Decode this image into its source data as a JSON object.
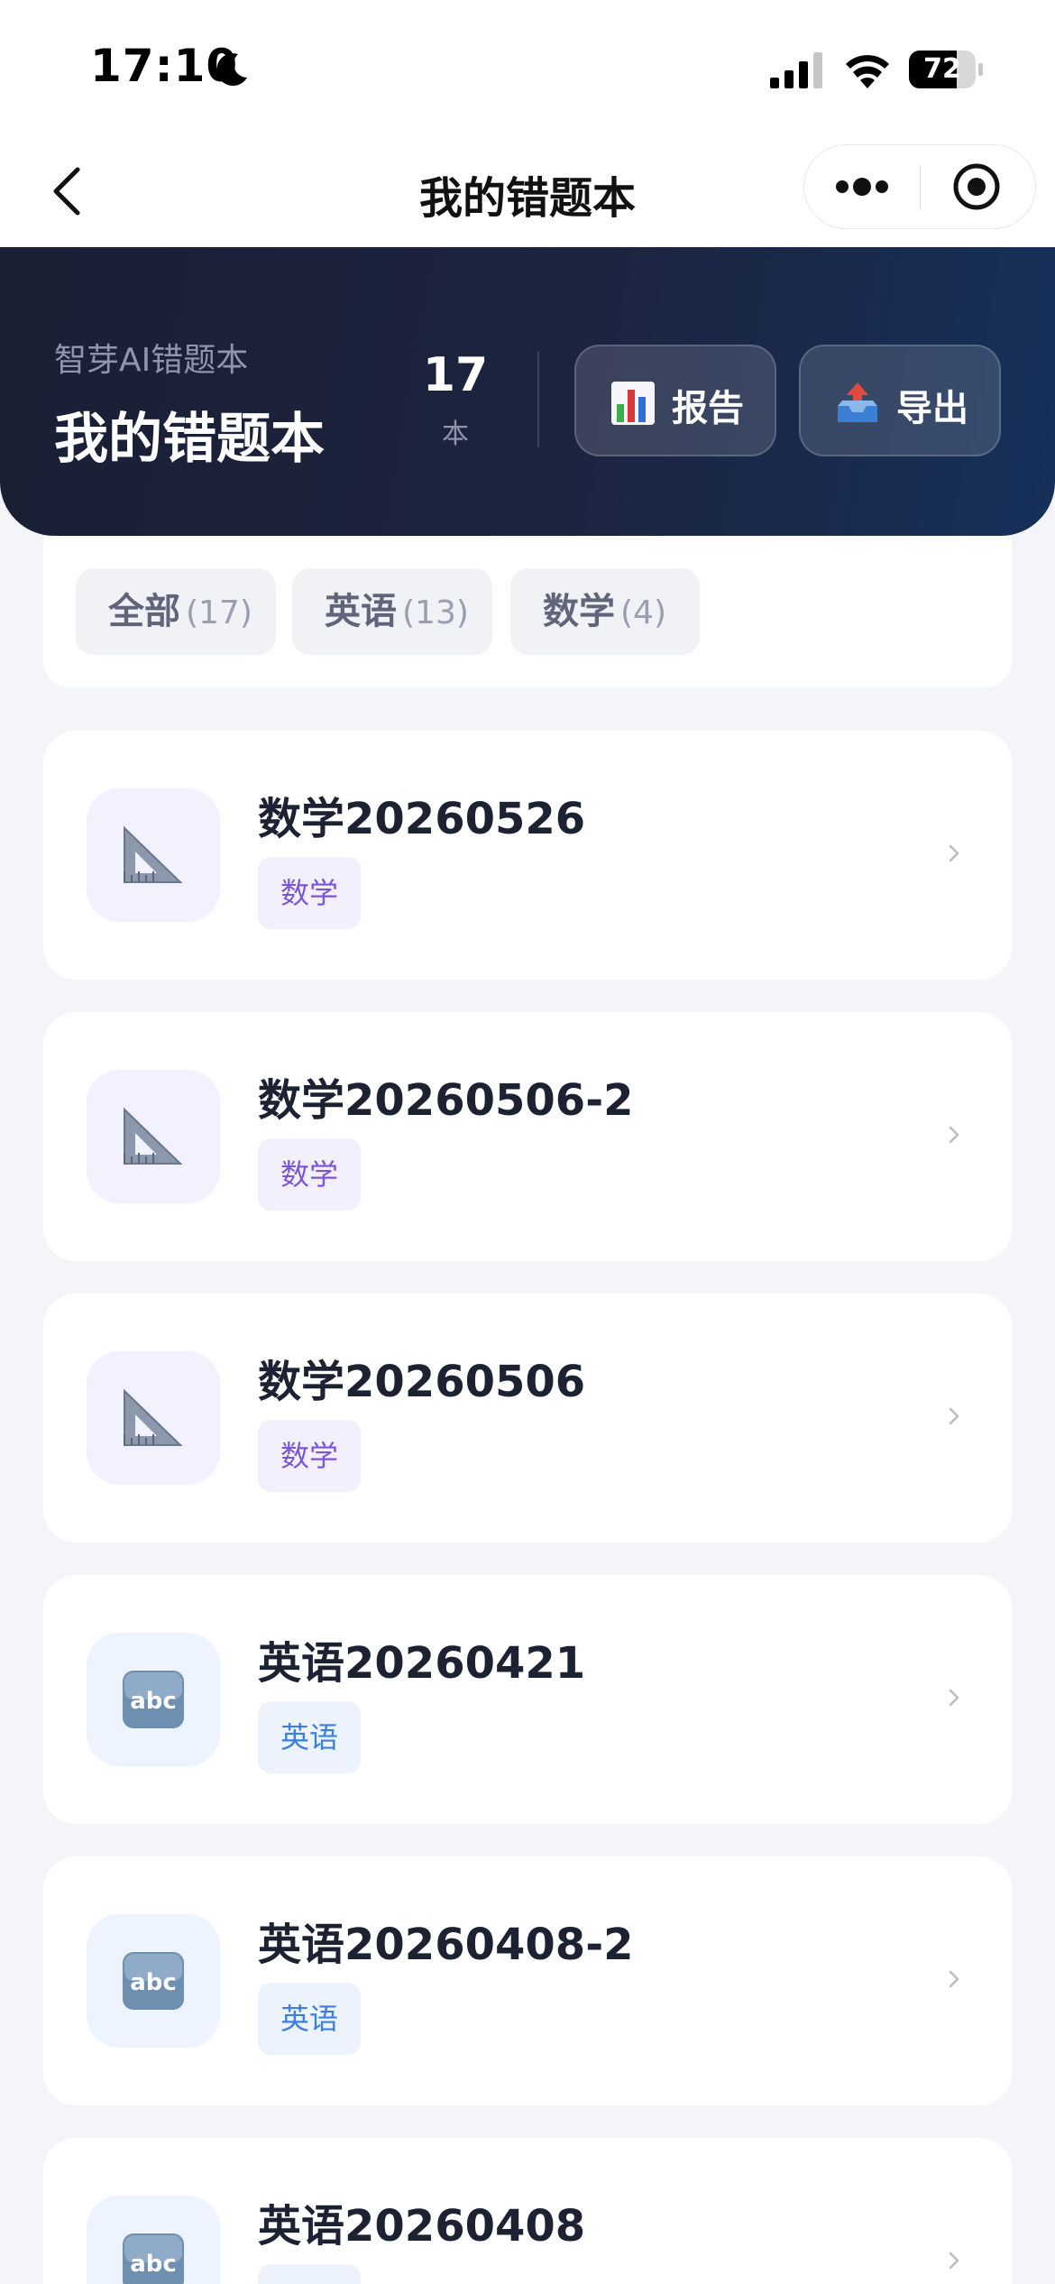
{
  "status_bar": {
    "time": "17:10",
    "battery_level": "72",
    "battery_fraction": 0.72,
    "icons": [
      "moon-icon",
      "signal-icon",
      "wifi-icon",
      "battery-icon"
    ]
  },
  "nav": {
    "title": "我的错题本",
    "icons": [
      "chevron-left-icon",
      "more-dots-icon",
      "record-circle-icon"
    ]
  },
  "header": {
    "subtitle": "智芽AI错题本",
    "title": "我的错题本",
    "count": "17",
    "count_unit": "本",
    "report_label": "报告",
    "export_label": "导出",
    "report_icon": "bar-chart-icon",
    "export_icon": "outbox-tray-icon"
  },
  "filters": [
    {
      "label": "全部",
      "count": "(17)",
      "active": true
    },
    {
      "label": "英语",
      "count": "(13)",
      "active": false
    },
    {
      "label": "数学",
      "count": "(4)",
      "active": false
    }
  ],
  "books": [
    {
      "title": "数学20260526",
      "tag": "数学",
      "subject": "math",
      "icon": "triangle-ruler-icon"
    },
    {
      "title": "数学20260506-2",
      "tag": "数学",
      "subject": "math",
      "icon": "triangle-ruler-icon"
    },
    {
      "title": "数学20260506",
      "tag": "数学",
      "subject": "math",
      "icon": "triangle-ruler-icon"
    },
    {
      "title": "英语20260421",
      "tag": "英语",
      "subject": "english",
      "icon": "abc-icon"
    },
    {
      "title": "英语20260408-2",
      "tag": "英语",
      "subject": "english",
      "icon": "abc-icon"
    },
    {
      "title": "英语20260408",
      "tag": "",
      "subject": "english",
      "icon": "abc-icon"
    }
  ],
  "colors": {
    "header_gradient_start": "#1a1f33",
    "header_gradient_end": "#16305a",
    "active_tab_start": "#6a72e6",
    "active_tab_end": "#7a4fc0",
    "math_tag": "#7b55d9",
    "english_tag": "#3d7fe0",
    "page_background": "#f4f5f9"
  }
}
